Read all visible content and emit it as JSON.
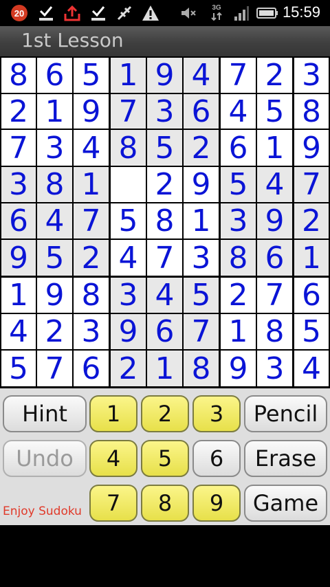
{
  "status_bar": {
    "notification_count": "20",
    "network_label": "3G",
    "time": "15:59",
    "icons": [
      "notification-badge",
      "download-check-icon",
      "upload-icon",
      "download-check-icon",
      "usb-debug-icon",
      "warning-icon",
      "mute-icon",
      "network-3g-icon",
      "signal-icon",
      "battery-icon"
    ]
  },
  "title_bar": {
    "title": "1st Lesson"
  },
  "board": {
    "rows": [
      [
        "8",
        "6",
        "5",
        "1",
        "9",
        "4",
        "7",
        "2",
        "3"
      ],
      [
        "2",
        "1",
        "9",
        "7",
        "3",
        "6",
        "4",
        "5",
        "8"
      ],
      [
        "7",
        "3",
        "4",
        "8",
        "5",
        "2",
        "6",
        "1",
        "9"
      ],
      [
        "3",
        "8",
        "1",
        "",
        "2",
        "9",
        "5",
        "4",
        "7"
      ],
      [
        "6",
        "4",
        "7",
        "5",
        "8",
        "1",
        "3",
        "9",
        "2"
      ],
      [
        "9",
        "5",
        "2",
        "4",
        "7",
        "3",
        "8",
        "6",
        "1"
      ],
      [
        "1",
        "9",
        "8",
        "3",
        "4",
        "5",
        "2",
        "7",
        "6"
      ],
      [
        "4",
        "2",
        "3",
        "9",
        "6",
        "7",
        "1",
        "8",
        "5"
      ],
      [
        "5",
        "7",
        "6",
        "2",
        "1",
        "8",
        "9",
        "3",
        "4"
      ]
    ],
    "digit_color": "#0a14d6"
  },
  "controls": {
    "hint": "Hint",
    "undo": "Undo",
    "pencil": "Pencil",
    "erase": "Erase",
    "game": "Game",
    "numbers": [
      {
        "label": "1",
        "highlighted": true
      },
      {
        "label": "2",
        "highlighted": true
      },
      {
        "label": "3",
        "highlighted": true
      },
      {
        "label": "4",
        "highlighted": true
      },
      {
        "label": "5",
        "highlighted": true
      },
      {
        "label": "6",
        "highlighted": false
      },
      {
        "label": "7",
        "highlighted": true
      },
      {
        "label": "8",
        "highlighted": true
      },
      {
        "label": "9",
        "highlighted": true
      }
    ],
    "footer": "Enjoy Sudoku"
  },
  "colors": {
    "accent_yellow": "#ece64f",
    "footer_red": "#e03a2a"
  }
}
